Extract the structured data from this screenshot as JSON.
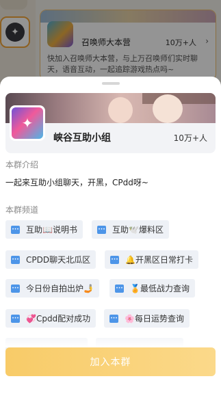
{
  "background": {
    "card": {
      "name": "召唤师大本营",
      "member_count": "10万+人",
      "arrow": "›",
      "description": "快加入召唤师大本营，与上万召唤师们实时聊天，语音互动，一起追踪游戏热点吗~"
    },
    "compass_icon": "compass-icon"
  },
  "sheet": {
    "group": {
      "name": "峡谷互助小组",
      "member_count": "10万+人"
    },
    "intro": {
      "title": "本群介绍",
      "text": "一起来互助小组聊天，开黑，CPdd呀~"
    },
    "channels": {
      "title": "本群频道",
      "items": [
        {
          "label": "互助📖说明书"
        },
        {
          "label": "互助🕊️爆料区"
        },
        {
          "label": "CPDD聊天北瓜区"
        },
        {
          "label": "🔔开黑区日常打卡"
        },
        {
          "label": "今日份自拍出炉🤳"
        },
        {
          "label": "🏅最低战力查询"
        },
        {
          "label": "💞Cpdd配对成功"
        },
        {
          "label": "🌸每日运势查询"
        }
      ]
    },
    "join_button": "加入本群"
  },
  "colors": {
    "accent": "#f8cb68",
    "chip_bg": "#eef1f6",
    "channel_icon": "#4d95e8"
  }
}
